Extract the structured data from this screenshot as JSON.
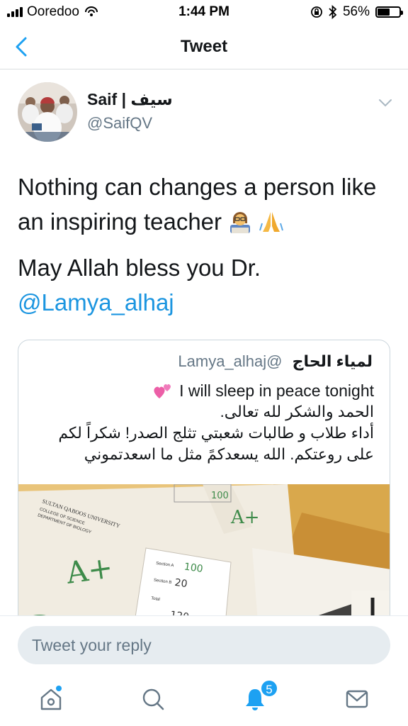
{
  "status_bar": {
    "carrier": "Ooredoo",
    "time": "1:44 PM",
    "battery": "56%",
    "battery_level": 0.56
  },
  "nav": {
    "title": "Tweet"
  },
  "tweet": {
    "author_name": "Saif | سيف",
    "author_handle": "@SaifQV",
    "line1": "Nothing can changes a person like",
    "line2": "an inspiring teacher",
    "line2_emojis": [
      "teacher-emoji",
      "folded-hands-emoji"
    ],
    "line3": "May Allah bless you Dr.",
    "mention": "@Lamya_alhaj"
  },
  "quote": {
    "name": "لمياء الحاج",
    "handle": "@Lamya_alhaj",
    "line_en": "I will sleep in peace tonight",
    "line_ar1": "الحمد والشكر لله تعالى.",
    "line_ar2": "أداء طلاب و طالبات شعبتي تثلج الصدر! شكراً لكم",
    "line_ar3": "على روعتكم. الله يسعدكمً مثل ما اسعدتموني",
    "image_texts": {
      "university": "SULTAN QABOOS UNIVERSITY",
      "college": "COLLEGE OF SCIENCE",
      "department": "DEPARTMENT OF BIOLOGY",
      "grade": "A+",
      "section_a": "Section A",
      "section_b": "Section B",
      "total": "Total",
      "score_100": "100",
      "score_20": "20",
      "score_120": "120"
    }
  },
  "reply": {
    "placeholder": "Tweet your reply"
  },
  "tabbar": {
    "notifications_count": "5",
    "icons": [
      "home-icon",
      "search-icon",
      "notifications-icon",
      "messages-icon"
    ]
  },
  "colors": {
    "accent": "#1da1f2",
    "link": "#1b95e0",
    "secondary_text": "#657786",
    "border": "#ccd6dd"
  }
}
